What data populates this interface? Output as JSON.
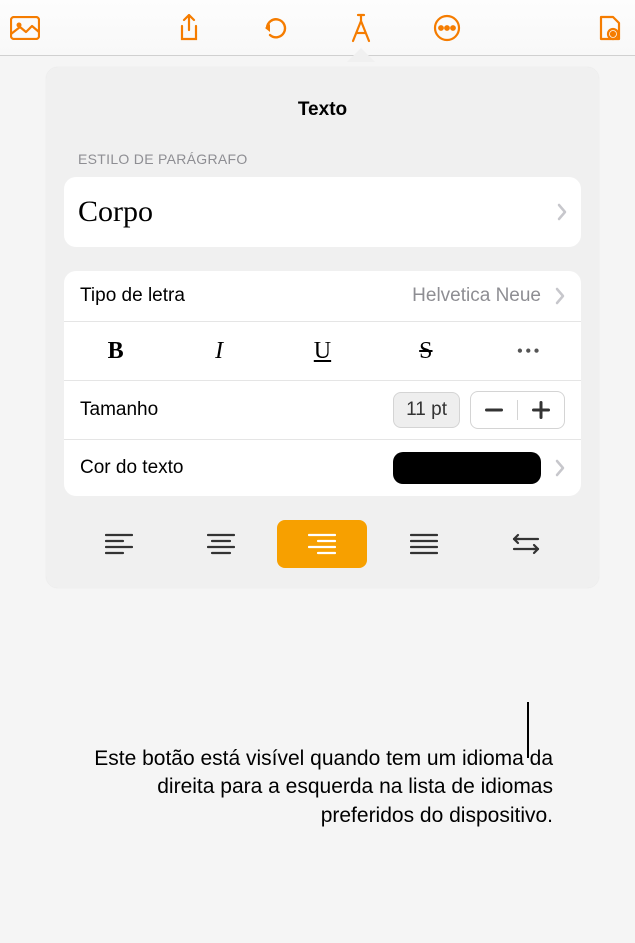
{
  "toolbar": {
    "icons": {
      "insert": "insert-icon",
      "share": "share-icon",
      "undo": "undo-icon",
      "format": "format-icon",
      "more": "more-icon",
      "document": "document-icon"
    }
  },
  "popover": {
    "title": "Texto",
    "paragraph_section": "ESTILO DE PARÁGRAFO",
    "style": "Corpo",
    "font": {
      "label": "Tipo de letra",
      "value": "Helvetica Neue"
    },
    "format": {
      "bold": "B",
      "italic": "I",
      "underline": "U",
      "strike": "S",
      "more": "•••"
    },
    "size": {
      "label": "Tamanho",
      "value": "11 pt"
    },
    "text_color": {
      "label": "Cor do texto",
      "hex": "#000000"
    },
    "alignment": {
      "selected": 2
    }
  },
  "callout": "Este botão está visível quando tem um idioma da direita para a esquerda na lista de idiomas preferidos do dispositivo."
}
